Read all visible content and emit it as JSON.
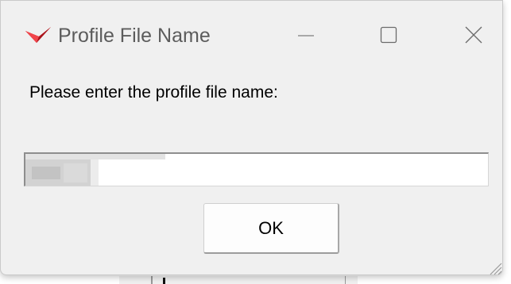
{
  "window": {
    "title": "Profile File Name",
    "icon": "red-chevron-logo-icon",
    "controls": [
      "minimize-icon",
      "maximize-icon",
      "close-icon"
    ]
  },
  "dialog": {
    "prompt": "Please enter the profile file name:",
    "input_value": "",
    "ok_label": "OK"
  },
  "colors": {
    "dialog_background": "#f0f0f0",
    "title_text": "#5c5c5c",
    "icon_red": "#e01e26"
  }
}
